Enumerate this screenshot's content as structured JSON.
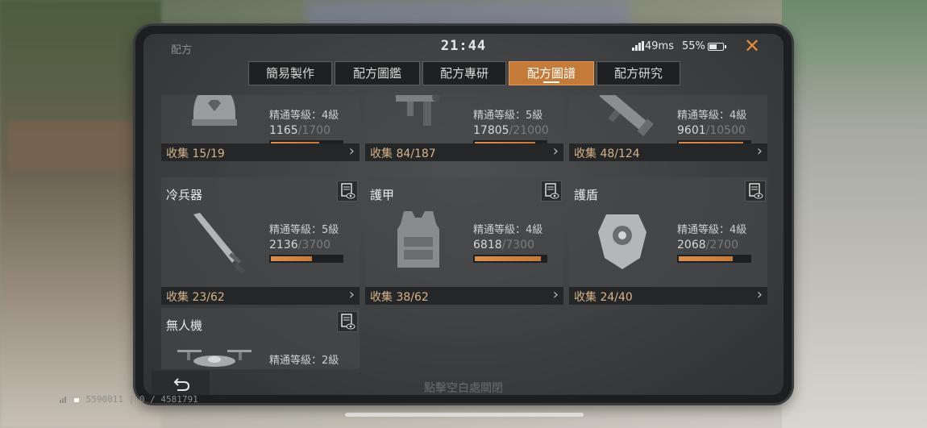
{
  "status": {
    "title": "配方",
    "time": "21:44",
    "ping": "49ms",
    "battery": "55%",
    "battery_level": 0.55
  },
  "tabs": [
    {
      "label": "簡易製作",
      "active": false
    },
    {
      "label": "配方圖鑑",
      "active": false
    },
    {
      "label": "配方專研",
      "active": false
    },
    {
      "label": "配方圖譜",
      "active": true
    },
    {
      "label": "配方研究",
      "active": false
    }
  ],
  "cards": [
    {
      "name": "",
      "icon": "helmet-icon",
      "level": "精通等級：4級",
      "cur": "1165",
      "max": "/1700",
      "ratio": 0.685,
      "collect": "收集 15/19"
    },
    {
      "name": "",
      "icon": "smg-icon",
      "level": "精通等級：5級",
      "cur": "17805",
      "max": "/21000",
      "ratio": 0.848,
      "collect": "收集 84/187"
    },
    {
      "name": "",
      "icon": "rocket-launcher-icon",
      "level": "精通等級：4級",
      "cur": "9601",
      "max": "/10500",
      "ratio": 0.914,
      "collect": "收集 48/124"
    },
    {
      "name": "冷兵器",
      "icon": "sword-icon",
      "level": "精通等級：5級",
      "cur": "2136",
      "max": "/3700",
      "ratio": 0.577,
      "collect": "收集 23/62"
    },
    {
      "name": "護甲",
      "icon": "body-armor-icon",
      "level": "精通等級：4級",
      "cur": "6818",
      "max": "/7300",
      "ratio": 0.934,
      "collect": "收集 38/62"
    },
    {
      "name": "護盾",
      "icon": "shield-armor-icon",
      "level": "精通等級：4級",
      "cur": "2068",
      "max": "/2700",
      "ratio": 0.766,
      "collect": "收集 24/40"
    },
    {
      "name": "無人機",
      "icon": "drone-icon",
      "level": "精通等級：2級",
      "cur": "",
      "max": "",
      "ratio": 0,
      "collect": ""
    }
  ],
  "hint": "點擊空白處關閉",
  "debug_line": "5590011 | 0 / 4581791",
  "colors": {
    "accent": "#c47a39",
    "close": "#e08a3c",
    "collect_text": "#d6b489"
  }
}
